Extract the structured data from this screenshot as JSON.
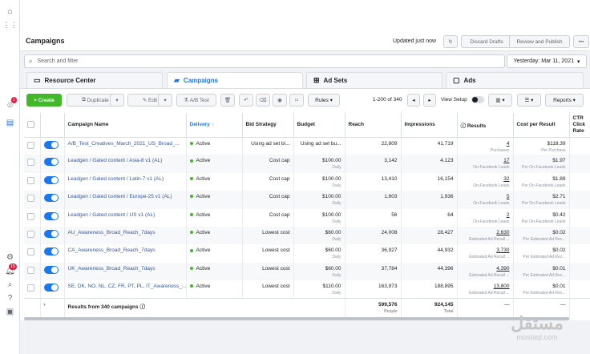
{
  "header": {
    "title": "Campaigns",
    "status": "Updated just now",
    "discard_label": "Discard Drafts",
    "review_label": "Review and Publish",
    "more_label": "•••"
  },
  "search": {
    "placeholder": "Search and filter"
  },
  "date_range": "Yesterday: Mar 11, 2021",
  "tabs": [
    {
      "label": "Resource Center"
    },
    {
      "label": "Campaigns"
    },
    {
      "label": "Ad Sets"
    },
    {
      "label": "Ads"
    }
  ],
  "toolbar": {
    "create": "Create",
    "duplicate": "Duplicate",
    "edit": "Edit",
    "ab_test": "A/B Test",
    "rules": "Rules",
    "pagination": "1-200 of 340",
    "view_setup": "View Setup",
    "reports": "Reports"
  },
  "rail": {
    "badge1": "1",
    "badge2": "15"
  },
  "columns": {
    "name": "Campaign Name",
    "delivery": "Delivery ↑",
    "bid": "Bid Strategy",
    "budget": "Budget",
    "reach": "Reach",
    "impressions": "Impressions",
    "results": "Results",
    "cpr": "Cost per Result",
    "ctr": "CTR Click Rate"
  },
  "rows": [
    {
      "name": "A/B_Test_Creatives_March_2021_US_Broad_...",
      "delivery": "Active",
      "bid": "Using ad set bi...",
      "budget": "Using ad set bu...",
      "budget_sub": "",
      "reach": "22,809",
      "impressions": "41,719",
      "results": "4",
      "results_sub": "Purchases",
      "cpr": "$118.39",
      "cpr_sub": "Per Purchase"
    },
    {
      "name": "Leadgen / Gated content / Asia-8 v1 (AL)",
      "delivery": "Active",
      "bid": "Cost cap",
      "budget": "$100.00",
      "budget_sub": "Daily",
      "reach": "3,142",
      "impressions": "4,123",
      "results": "17",
      "results_sub": "On-Facebook Leads",
      "cpr": "$1.97",
      "cpr_sub": "Per On-Facebook Leads"
    },
    {
      "name": "Leadgen / Gated content / Latin-7 v1 (AL)",
      "delivery": "Active",
      "bid": "Cost cap",
      "budget": "$100.00",
      "budget_sub": "Daily",
      "reach": "13,410",
      "impressions": "16,154",
      "results": "32",
      "results_sub": "On-Facebook Leads",
      "cpr": "$1.89",
      "cpr_sub": "Per On-Facebook Leads"
    },
    {
      "name": "Leadgen / Gated content / Europe-25 v1 (AL)",
      "delivery": "Active",
      "bid": "Cost cap",
      "budget": "$100.00",
      "budget_sub": "Daily",
      "reach": "1,603",
      "impressions": "1,936",
      "results": "5",
      "results_sub": "On-Facebook Leads",
      "cpr": "$2.71",
      "cpr_sub": "Per On-Facebook Leads"
    },
    {
      "name": "Leadgen / Gated content / US v1 (AL)",
      "delivery": "Active",
      "bid": "Cost cap",
      "budget": "$100.00",
      "budget_sub": "Daily",
      "reach": "56",
      "impressions": "64",
      "results": "2",
      "results_sub": "On-Facebook Leads",
      "cpr": "$0.42",
      "cpr_sub": "Per On-Facebook Leads"
    },
    {
      "name": "AU_Awareness_Broad_Reach_7days",
      "delivery": "Active",
      "bid": "Lowest cost",
      "budget": "$60.00",
      "budget_sub": "Daily",
      "reach": "24,008",
      "impressions": "28,427",
      "results": "2,630",
      "results_sub": "Estimated Ad Recall ...",
      "cpr": "$0.02",
      "cpr_sub": "Per Estimated Ad Rec..."
    },
    {
      "name": "CA_Awareness_Broad_Reach_7days",
      "delivery": "Active",
      "bid": "Lowest cost",
      "budget": "$60.00",
      "budget_sub": "Daily",
      "reach": "36,927",
      "impressions": "44,932",
      "results": "3,730",
      "results_sub": "Estimated Ad Recall ...",
      "cpr": "$0.02",
      "cpr_sub": "Per Estimated Ad Rec..."
    },
    {
      "name": "UK_Awareness_Broad_Reach_7days",
      "delivery": "Active",
      "bid": "Lowest cost",
      "budget": "$60.00",
      "budget_sub": "Daily",
      "reach": "37,784",
      "impressions": "44,396",
      "results": "4,390",
      "results_sub": "Estimated Ad Recall ...",
      "cpr": "$0.01",
      "cpr_sub": "Per Estimated Ad Rec..."
    },
    {
      "name": "SE, DK, NO, NL, CZ, FR, PT, PL, IT_Awareness_...",
      "delivery": "Active",
      "bid": "Lowest cost",
      "budget": "$110.00",
      "budget_sub": "Daily",
      "reach": "163,973",
      "impressions": "188,895",
      "results": "13,800",
      "results_sub": "Estimated Ad Recall ...",
      "cpr": "$0.01",
      "cpr_sub": "Per Estimated Ad Rec..."
    }
  ],
  "totals": {
    "label": "Results from 340 campaigns",
    "reach": "599,576",
    "reach_sub": "People",
    "impressions": "924,145",
    "impressions_sub": "Total",
    "results": "—",
    "cpr": "—"
  },
  "watermark": {
    "arabic": "مستقل",
    "latin": "mostaqi.com"
  }
}
